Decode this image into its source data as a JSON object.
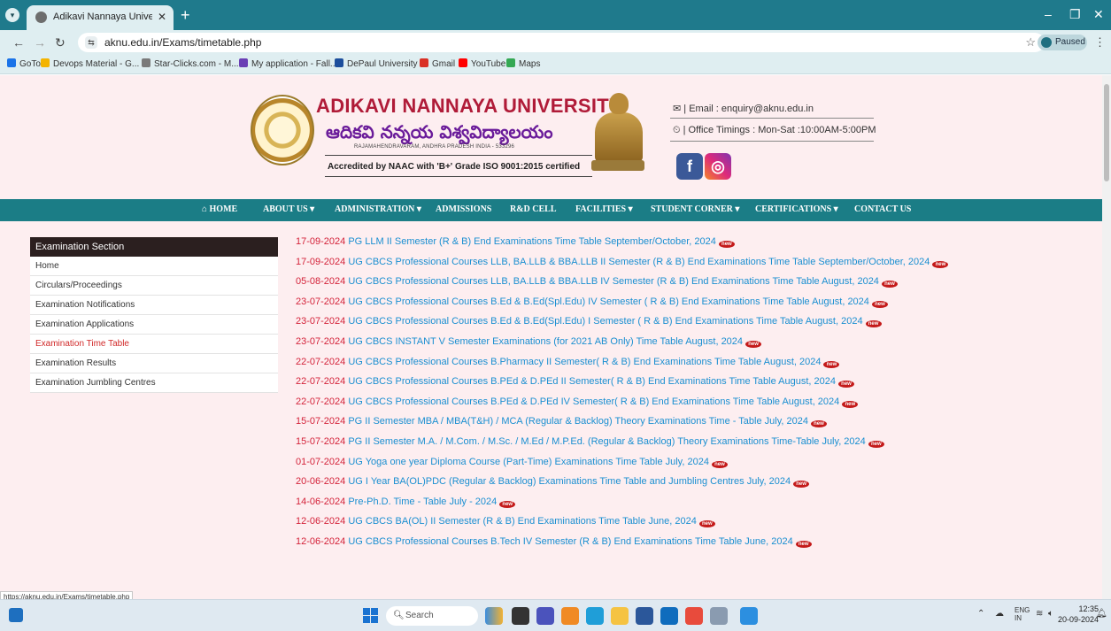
{
  "browser": {
    "tab_title": "Adikavi Nannaya University | Ra",
    "url": "aknu.edu.in/Exams/timetable.php",
    "paused_label": "Paused",
    "status_url": "https://aknu.edu.in/Exams/timetable.php",
    "bookmarks": [
      {
        "label": "GoTo",
        "color": "#1a73e8"
      },
      {
        "label": "Devops Material - G...",
        "color": "#f4b400"
      },
      {
        "label": "Star-Clicks.com - M...",
        "color": "#7a7a7a"
      },
      {
        "label": "My application - Fall...",
        "color": "#6a3fb5"
      },
      {
        "label": "DePaul University",
        "color": "#1c4e9c"
      },
      {
        "label": "Gmail",
        "color": "#d93025"
      },
      {
        "label": "YouTube",
        "color": "#ff0000"
      },
      {
        "label": "Maps",
        "color": "#34a853"
      }
    ]
  },
  "header": {
    "title": "ADIKAVI NANNAYA UNIVERSITY",
    "telugu_title": "ఆదికవి నన్నయ విశ్వవిద్యాలయం",
    "place": "RAJAMAHENDRAVARAM, ANDHRA PRADESH INDIA - 533296",
    "accreditation": "Accredited by NAAC with 'B+' Grade ISO 9001:2015 certified",
    "email": "| Email : enquiry@aknu.edu.in",
    "timings": "| Office Timings : Mon-Sat :10:00AM-5:00PM"
  },
  "nav": {
    "items": [
      "HOME",
      "ABOUT US",
      "ADMINISTRATION",
      "ADMISSIONS",
      "R&D CELL",
      "FACILITIES",
      "STUDENT CORNER",
      "CERTIFICATIONS",
      "CONTACT US"
    ]
  },
  "sidebar": {
    "heading": "Examination Section",
    "items": [
      "Home",
      "Circulars/Proceedings",
      "Examination Notifications",
      "Examination Applications",
      "Examination Time Table",
      "Examination Results",
      "Examination Jumbling Centres"
    ],
    "active_index": 4
  },
  "timetables": [
    {
      "date": "17-09-2024",
      "text": "PG LLM II Semester (R & B) End Examinations Time Table September/October, 2024"
    },
    {
      "date": "17-09-2024",
      "text": "UG CBCS Professional Courses LLB, BA.LLB & BBA.LLB II Semester (R & B) End Examinations Time Table September/October, 2024"
    },
    {
      "date": "05-08-2024",
      "text": "UG CBCS Professional Courses LLB, BA.LLB & BBA.LLB IV Semester (R & B) End Examinations Time Table August, 2024"
    },
    {
      "date": "23-07-2024",
      "text": "UG CBCS Professional Courses B.Ed & B.Ed(Spl.Edu) IV Semester ( R & B) End Examinations Time Table August, 2024"
    },
    {
      "date": "23-07-2024",
      "text": "UG CBCS Professional Courses B.Ed & B.Ed(Spl.Edu) I Semester ( R & B) End Examinations Time Table August, 2024"
    },
    {
      "date": "23-07-2024",
      "text": "UG CBCS INSTANT V Semester Examinations (for 2021 AB Only) Time Table August, 2024"
    },
    {
      "date": "22-07-2024",
      "text": "UG CBCS Professional Courses B.Pharmacy II Semester( R & B) End Examinations Time Table August, 2024"
    },
    {
      "date": "22-07-2024",
      "text": "UG CBCS Professional Courses B.PEd & D.PEd II Semester( R & B) End Examinations Time Table August, 2024"
    },
    {
      "date": "22-07-2024",
      "text": "UG CBCS Professional Courses B.PEd & D.PEd IV Semester( R & B) End Examinations Time Table August, 2024"
    },
    {
      "date": "15-07-2024",
      "text": "PG II Semester MBA / MBA(T&H) / MCA (Regular & Backlog) Theory Examinations Time - Table July, 2024"
    },
    {
      "date": "15-07-2024",
      "text": "PG II Semester M.A. / M.Com. / M.Sc. / M.Ed / M.P.Ed. (Regular & Backlog) Theory Examinations Time-Table July, 2024"
    },
    {
      "date": "01-07-2024",
      "text": "UG Yoga one year Diploma Course (Part-Time) Examinations Time Table July, 2024"
    },
    {
      "date": "20-06-2024",
      "text": "UG I Year BA(OL)PDC (Regular & Backlog) Examinations Time Table and Jumbling Centres July, 2024"
    },
    {
      "date": "14-06-2024",
      "text": "Pre-Ph.D. Time - Table July - 2024"
    },
    {
      "date": "12-06-2024",
      "text": "UG CBCS BA(OL) II Semester (R & B) End Examinations Time Table June, 2024"
    },
    {
      "date": "12-06-2024",
      "text": "UG CBCS Professional Courses B.Tech IV Semester (R & B) End Examinations Time Table June, 2024"
    }
  ],
  "badge_label": "new",
  "taskbar": {
    "search_placeholder": "Search",
    "lang": "ENG",
    "region": "IN",
    "time": "12:35",
    "date": "20-09-2024"
  },
  "colors": {
    "navbar": "#1b7d86",
    "date": "#d4233a",
    "link": "#1a8fd1",
    "title": "#b01b38"
  }
}
